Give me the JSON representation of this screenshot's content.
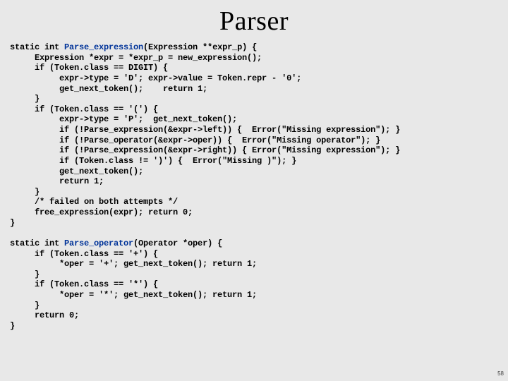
{
  "title": "Parser",
  "code": {
    "l01a": "static int ",
    "l01b": "Parse_expression",
    "l01c": "(Expression **expr_p) {",
    "l02": "     Expression *expr = *expr_p = new_expression();",
    "l03": "     if (Token.class == DIGIT) {",
    "l04": "          expr->type = 'D'; expr->value = Token.repr - '0';",
    "l05": "          get_next_token();    return 1;",
    "l06": "     }",
    "l07": "     if (Token.class == '(') {",
    "l08": "          expr->type = 'P';  get_next_token();",
    "l09": "          if (!Parse_expression(&expr->left)) {  Error(\"Missing expression\"); }",
    "l10": "          if (!Parse_operator(&expr->oper)) {  Error(\"Missing operator\"); }",
    "l11": "          if (!Parse_expression(&expr->right)) { Error(\"Missing expression\"); }",
    "l12": "          if (Token.class != ')') {  Error(\"Missing )\"); }",
    "l13": "          get_next_token();",
    "l14": "          return 1;",
    "l15": "     }",
    "l16": "     /* failed on both attempts */",
    "l17": "     free_expression(expr); return 0;",
    "l18": "}",
    "l20a": "static int ",
    "l20b": "Parse_operator",
    "l20c": "(Operator *oper) {",
    "l21": "     if (Token.class == '+') {",
    "l22": "          *oper = '+'; get_next_token(); return 1;",
    "l23": "     }",
    "l24": "     if (Token.class == '*') {",
    "l25": "          *oper = '*'; get_next_token(); return 1;",
    "l26": "     }",
    "l27": "     return 0;",
    "l28": "}"
  },
  "pagenum": "58"
}
